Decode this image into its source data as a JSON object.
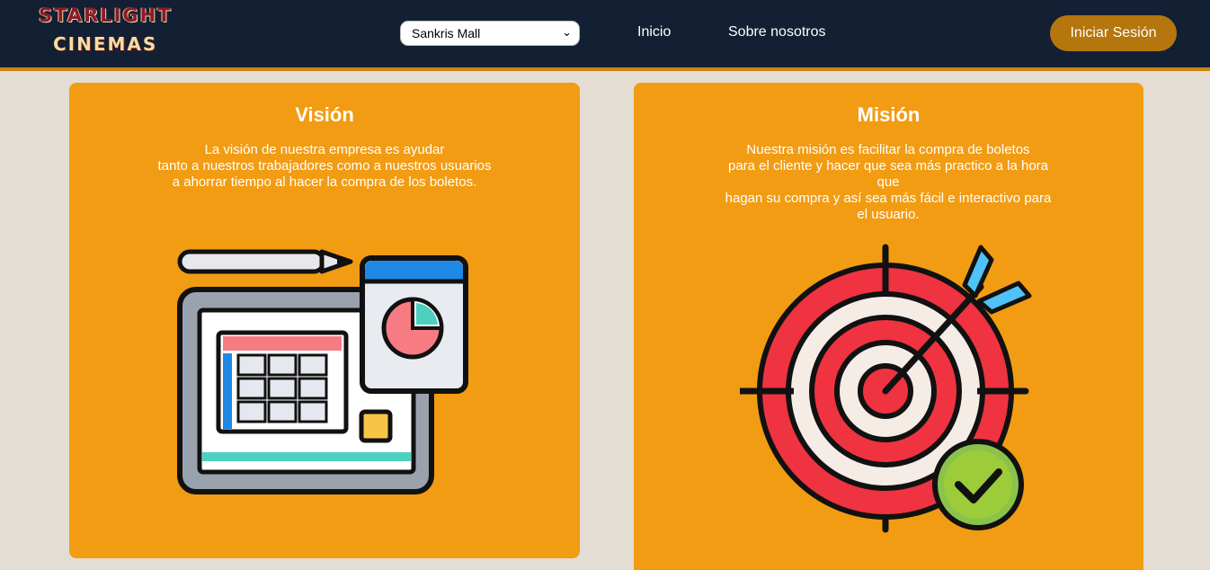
{
  "header": {
    "logo": {
      "line1": "STARLIGHT",
      "line2": "CINEMAS"
    },
    "location_select": {
      "selected": "Sankris Mall"
    },
    "nav": [
      {
        "label": "Inicio"
      },
      {
        "label": "Sobre nosotros"
      }
    ],
    "login_label": "Iniciar Sesión"
  },
  "vision": {
    "title": "Visión",
    "lines": [
      "La visión de nuestra empresa es ayudar",
      "tanto a nuestros trabajadores como a nuestros usuarios",
      "a ahorrar tiempo al hacer la compra de los boletos."
    ],
    "icon": "dashboard-chart-icon"
  },
  "mision": {
    "title": "Misión",
    "lines": [
      "Nuestra misión es facilitar la compra de boletos",
      "para el cliente y hacer que sea más practico a la hora que",
      "hagan su compra y así sea más fácil e interactivo para el usuario."
    ],
    "icon": "target-arrow-icon"
  },
  "colors": {
    "navbar": "#132033",
    "accent": "#c8860f",
    "card": "#f29c13",
    "page_bg": "#e4ddd3",
    "login_button": "#b5760e"
  }
}
